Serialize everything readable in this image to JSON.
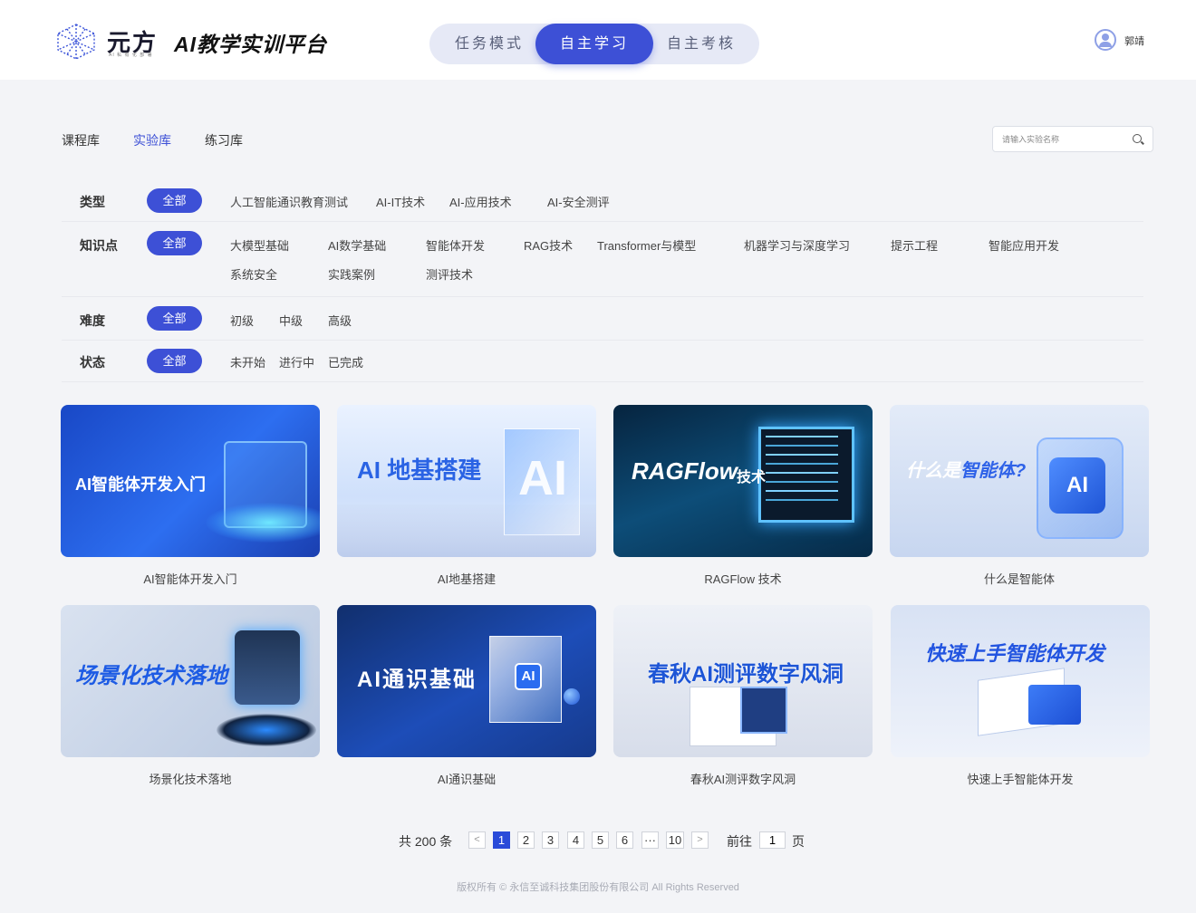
{
  "header": {
    "brand": "元方",
    "brand_sub": "AI 私 有 化 部 署",
    "title": "AI教学实训平台",
    "modes": [
      "任务模式",
      "自主学习",
      "自主考核"
    ],
    "active_mode": "自主学习",
    "user_name": "郭靖"
  },
  "library_tabs": [
    "课程库",
    "实验库",
    "练习库"
  ],
  "active_library": "实验库",
  "search": {
    "placeholder": "请输入实验名称"
  },
  "filters": {
    "type": {
      "label": "类型",
      "all": "全部",
      "options": [
        "人工智能通识教育测试",
        "AI-IT技术",
        "AI-应用技术",
        "AI-安全测评"
      ]
    },
    "knowledge": {
      "label": "知识点",
      "all": "全部",
      "options": [
        "大模型基础",
        "AI数学基础",
        "智能体开发",
        "RAG技术",
        "Transformer与模型",
        "机器学习与深度学习",
        "提示工程",
        "智能应用开发",
        "系统安全",
        "实践案例",
        "测评技术"
      ]
    },
    "difficulty": {
      "label": "难度",
      "all": "全部",
      "options": [
        "初级",
        "中级",
        "高级"
      ]
    },
    "status": {
      "label": "状态",
      "all": "全部",
      "options": [
        "未开始",
        "进行中",
        "已完成"
      ]
    }
  },
  "cards": [
    {
      "title": "AI智能体开发入门",
      "thumb_text": "AI智能体开发入门"
    },
    {
      "title": "AI地基搭建",
      "thumb_text": "AI 地基搭建",
      "thumb_mark": "AI"
    },
    {
      "title": "RAGFlow 技术",
      "thumb_text": "RAGFlow",
      "thumb_sub": "技术"
    },
    {
      "title": "什么是智能体",
      "thumb_text_a": "什么是",
      "thumb_text_b": "智能体?",
      "thumb_mark": "AI"
    },
    {
      "title": "场景化技术落地",
      "thumb_text": "场景化技术落地"
    },
    {
      "title": "AI通识基础",
      "thumb_text": "AI通识基础",
      "thumb_mark": "AI"
    },
    {
      "title": "春秋AI测评数字风洞",
      "thumb_text": "春秋AI测评数字风洞"
    },
    {
      "title": "快速上手智能体开发",
      "thumb_text": "快速上手智能体开发"
    }
  ],
  "pagination": {
    "total_text": "共 200 条",
    "prev": "<",
    "pages": [
      "1",
      "2",
      "3",
      "4",
      "5",
      "6",
      "···",
      "10"
    ],
    "current": "1",
    "next": ">",
    "goto_label": "前往",
    "goto_value": "1",
    "goto_suffix": "页"
  },
  "footer": "版权所有 © 永信至诚科技集团股份有限公司 All Rights Reserved",
  "colors": {
    "accent": "#3d50d6",
    "page_bg": "#f3f4f7"
  }
}
